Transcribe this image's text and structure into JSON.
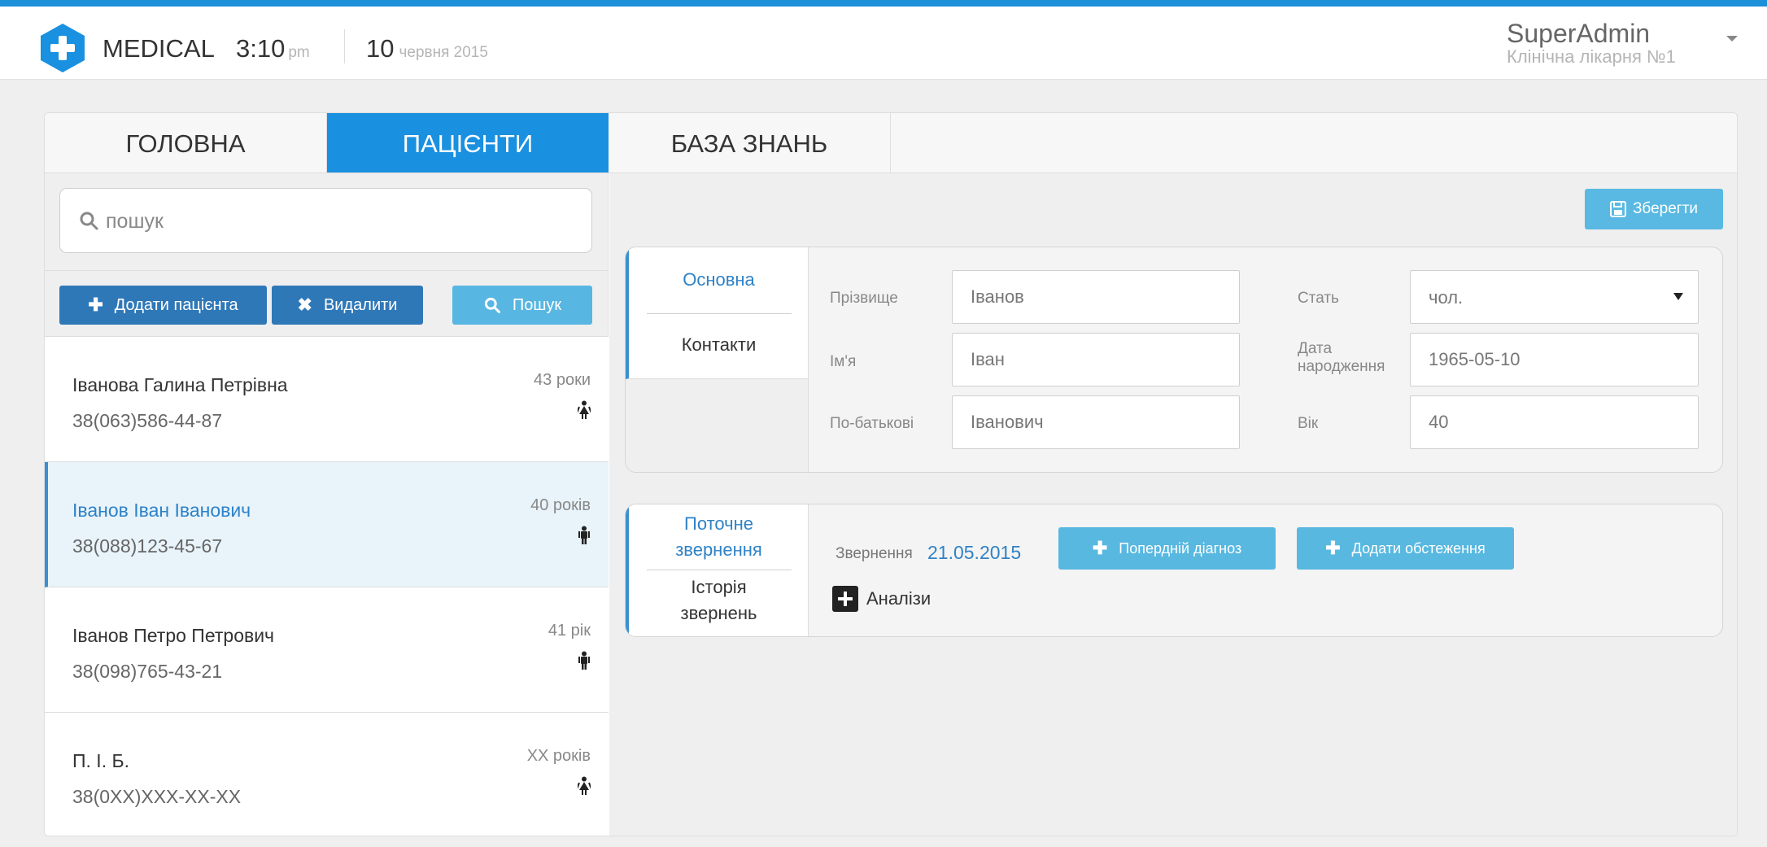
{
  "header": {
    "app_name": "MEDICAL",
    "time": "3:10",
    "ampm": "pm",
    "day": "10",
    "month_year": "червня 2015",
    "user_name": "SuperAdmin",
    "user_org": "Клінічна лікарня №1",
    "logo_icon": "medical-cross-hexagon-icon",
    "accent_color": "#1a90e0"
  },
  "tabs": [
    {
      "label": "ГОЛОВНА",
      "active": false
    },
    {
      "label": "ПАЦІЄНТИ",
      "active": true
    },
    {
      "label": "БАЗА ЗНАНЬ",
      "active": false
    }
  ],
  "left": {
    "search_placeholder": "пошук",
    "add_button": "Додати пацієнта",
    "delete_button": "Видалити",
    "search_button": "Пошук",
    "patients": [
      {
        "name": "Іванова Галина Петрівна",
        "phone": "38(063)586-44-87",
        "age": "43 роки",
        "gender_icon": "female-icon",
        "selected": false
      },
      {
        "name": "Іванов Іван Іванович",
        "phone": "38(088)123-45-67",
        "age": "40 років",
        "gender_icon": "male-icon",
        "selected": true
      },
      {
        "name": "Іванов Петро Петрович",
        "phone": "38(098)765-43-21",
        "age": "41 рік",
        "gender_icon": "male-icon",
        "selected": false
      },
      {
        "name": "П. І. Б.",
        "phone": "38(0XX)XXX-XX-XX",
        "age": "XX років",
        "gender_icon": "female-icon",
        "selected": false
      }
    ]
  },
  "right": {
    "save_button": "Зберегти",
    "info_panel": {
      "tab_main": "Основна",
      "tab_contacts": "Контакти",
      "surname_label": "Прізвище",
      "surname_value": "Іванов",
      "name_label": "Ім'я",
      "name_value": "Іван",
      "patronymic_label": "По-батькові",
      "patronymic_value": "Іванович",
      "gender_label": "Стать",
      "gender_value": "чол.",
      "birth_label_1": "Дата",
      "birth_label_2": "народження",
      "birth_value": "1965-05-10",
      "age_label": "Вік",
      "age_value": "40"
    },
    "appeal_panel": {
      "tab_current_1": "Поточне",
      "tab_current_2": "звернення",
      "tab_history_1": "Історія",
      "tab_history_2": "звернень",
      "appeal_label": "Звернення",
      "appeal_date": "21.05.2015",
      "prev_diagnosis_button": "Попердній діагноз",
      "add_exam_button": "Додати обстеження",
      "analyses_label": "Аналізи"
    }
  }
}
